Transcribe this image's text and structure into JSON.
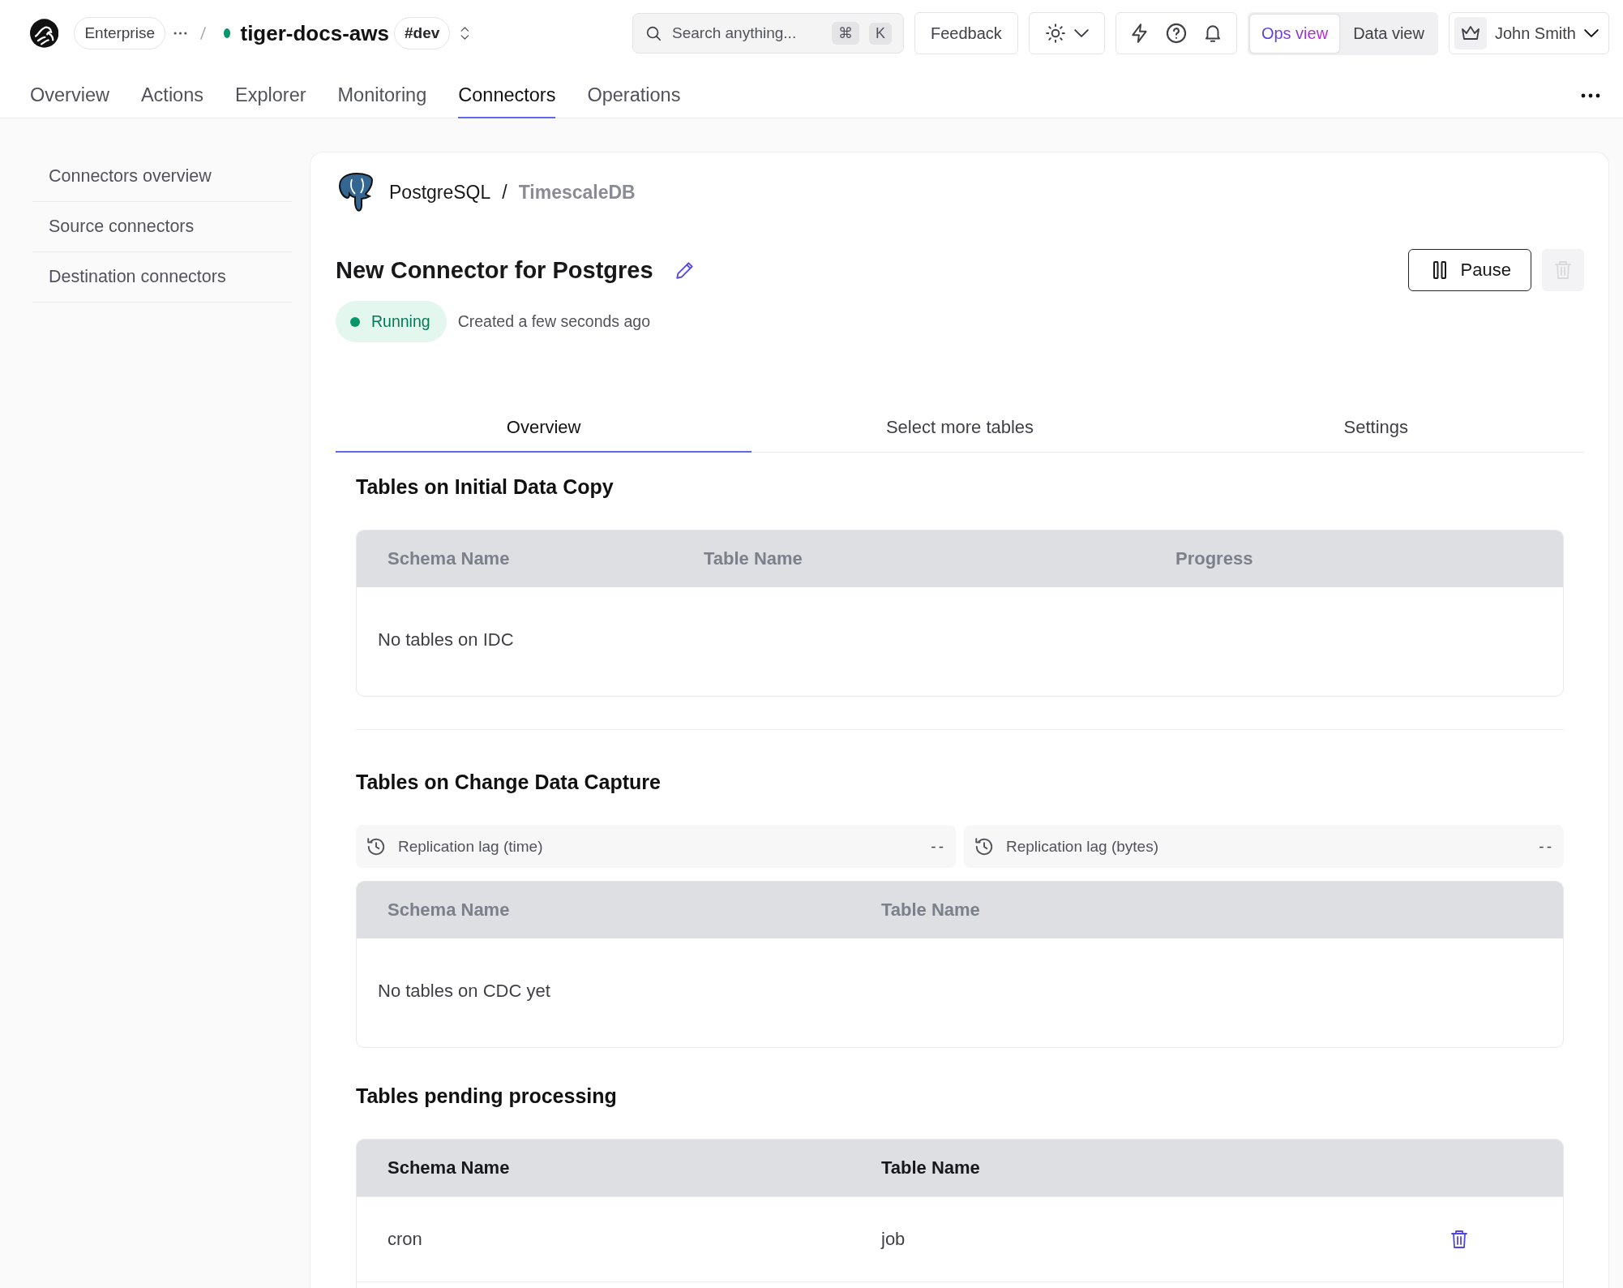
{
  "header": {
    "org": "Enterprise",
    "service": "tiger-docs-aws",
    "env_tag": "#dev",
    "search": {
      "placeholder": "Search anything...",
      "shortcut_keys": [
        "⌘",
        "K"
      ]
    },
    "feedback": "Feedback",
    "views": [
      {
        "label": "Ops view",
        "selected": true
      },
      {
        "label": "Data view",
        "selected": false
      }
    ],
    "user": "John Smith"
  },
  "nav": [
    {
      "label": "Overview",
      "selected": false
    },
    {
      "label": "Actions",
      "selected": false
    },
    {
      "label": "Explorer",
      "selected": false
    },
    {
      "label": "Monitoring",
      "selected": false
    },
    {
      "label": "Connectors",
      "selected": true
    },
    {
      "label": "Operations",
      "selected": false
    }
  ],
  "sidebar": {
    "items": [
      "Connectors overview",
      "Source connectors",
      "Destination connectors"
    ]
  },
  "connector": {
    "source": "PostgreSQL",
    "separator": "/",
    "destination": "TimescaleDB",
    "name": "New Connector for Postgres",
    "status": "Running",
    "created": "Created a few seconds ago",
    "pause_button": "Pause",
    "delete_disabled": true
  },
  "tabs": [
    {
      "label": "Overview",
      "selected": true
    },
    {
      "label": "Select more tables",
      "selected": false
    },
    {
      "label": "Settings",
      "selected": false
    }
  ],
  "sections": [
    {
      "title": "Tables on Initial Data Copy",
      "header_disabled": true,
      "columns": [
        "Schema Name",
        "Table Name",
        "Progress"
      ],
      "empty_text": "No tables on IDC"
    },
    {
      "title": "Tables on Change Data Capture",
      "metrics": [
        {
          "label": "Replication lag (time)",
          "value": "--"
        },
        {
          "label": "Replication lag (bytes)",
          "value": "--"
        }
      ],
      "header_disabled": true,
      "columns": [
        "Schema Name",
        "Table Name"
      ],
      "empty_text": "No tables on CDC yet"
    },
    {
      "title": "Tables pending processing",
      "header_disabled": false,
      "columns": [
        "Schema Name",
        "Table Name"
      ],
      "row_delete": true,
      "rows": [
        [
          "cron",
          "job"
        ]
      ]
    }
  ]
}
